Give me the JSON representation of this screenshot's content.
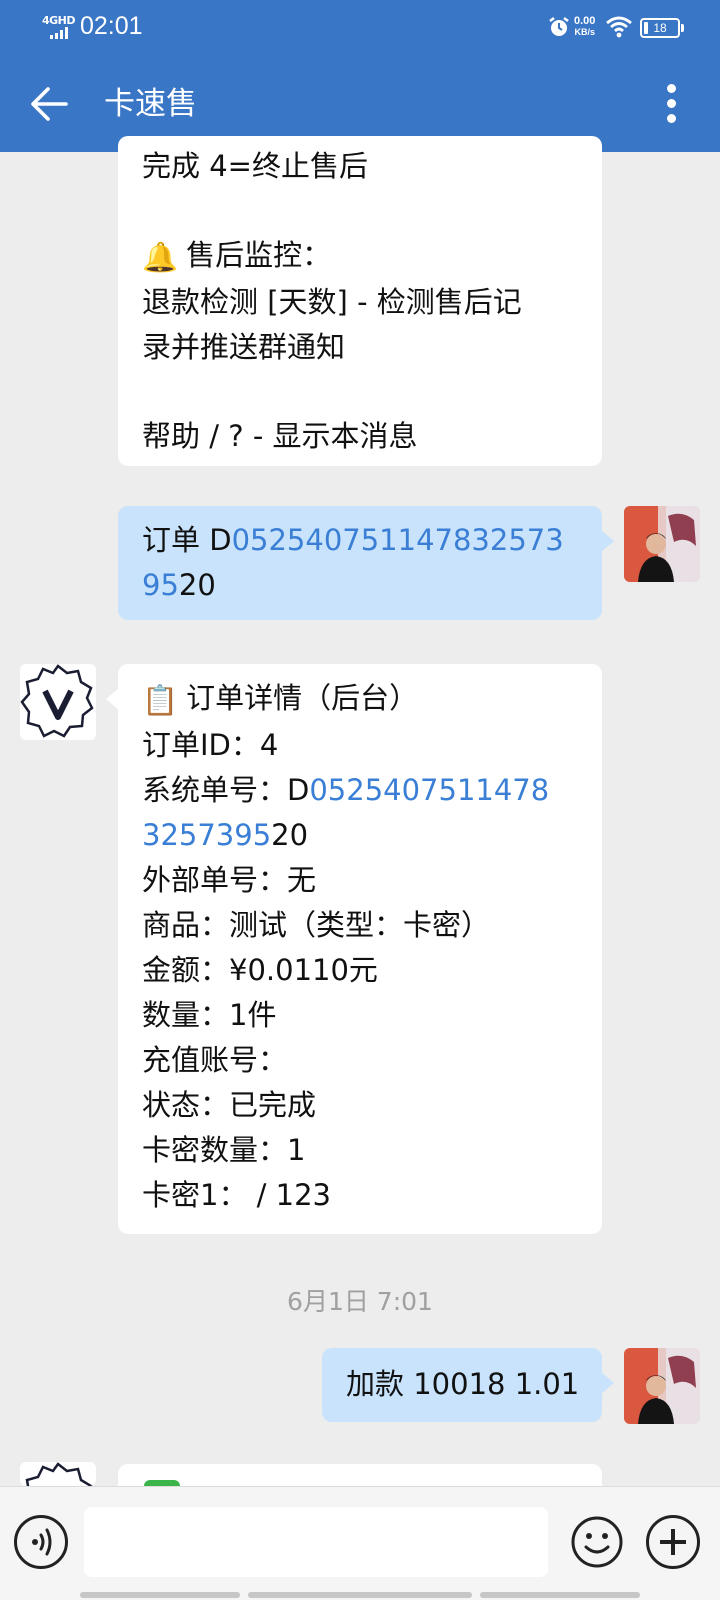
{
  "status_bar": {
    "network": "4GHD",
    "time": "02:01",
    "net_speed_value": "0.00",
    "net_speed_unit": "KB/s",
    "battery": "18"
  },
  "header": {
    "title": "卡速售"
  },
  "messages": {
    "help": {
      "lines": [
        "完成 4=终止售后",
        "",
        "售后监控：",
        "退款检测 [天数]  - 检测售后记",
        "录并推送群通知",
        "",
        "帮助 / ?       - 显示本消息"
      ],
      "emoji": "🔔"
    },
    "user_order": {
      "prefix": "订单 D",
      "link": "052540751147832573",
      "link2": "95",
      "suffix": "20"
    },
    "order_detail": {
      "emoji": "📋",
      "title": "订单详情（后台）",
      "order_id": "订单ID：4",
      "sys_no_prefix": "系统单号：D",
      "sys_no_link1": "0525407511478",
      "sys_no_link2": "325739",
      "sys_no_link3": "5",
      "sys_no_suffix": "20",
      "ext_no": "外部单号：无",
      "product": "商品：测试（类型：卡密）",
      "amount": "金额：¥0.0110元",
      "quantity": "数量：1件",
      "account": "充值账号：",
      "status": "状态：已完成",
      "card_count": "卡密数量：1",
      "card1": "卡密1：  / 123"
    },
    "timestamp": "6月1日  7:01",
    "user_add": {
      "text": "加款 10018 1.01"
    }
  },
  "input": {
    "placeholder": ""
  },
  "colors": {
    "header": "#3a76c6",
    "link": "#3a7fd5",
    "user_bubble": "#c8e3fb"
  }
}
